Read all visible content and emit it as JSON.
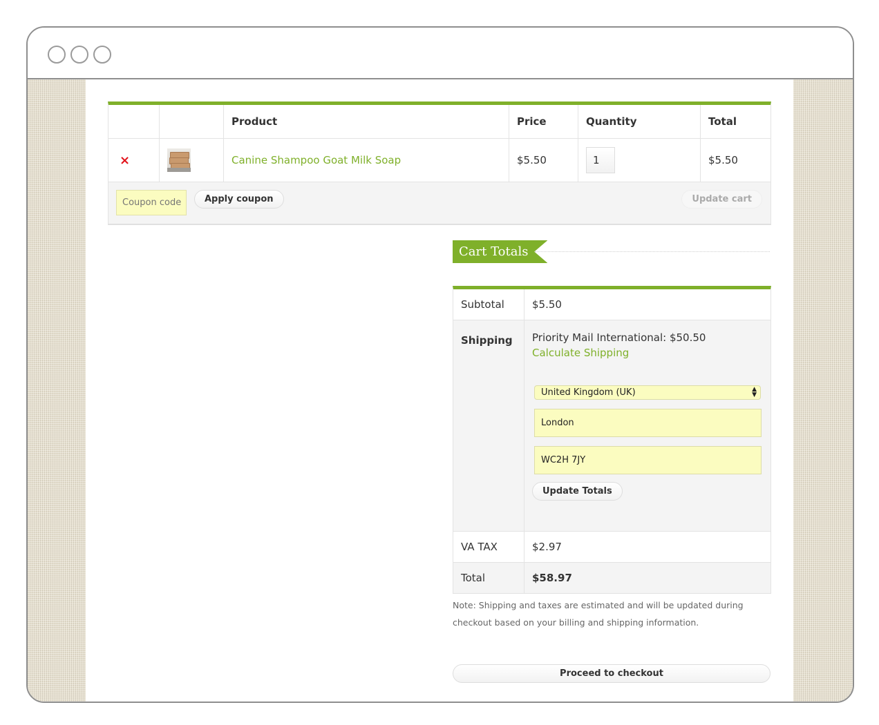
{
  "window": {
    "controls": [
      "close",
      "minimize",
      "maximize"
    ]
  },
  "cart": {
    "headers": [
      "",
      "",
      "Product",
      "Price",
      "Quantity",
      "Total"
    ],
    "items": [
      {
        "remove_icon": "×",
        "thumbnail": "soap-bars-image",
        "product": "Canine Shampoo Goat Milk Soap",
        "price": "$5.50",
        "quantity": "1",
        "total": "$5.50"
      }
    ],
    "coupon_placeholder": "Coupon code",
    "apply_coupon_label": "Apply coupon",
    "update_cart_label": "Update cart"
  },
  "totals": {
    "title": "Cart Totals",
    "subtotal_label": "Subtotal",
    "subtotal_value": "$5.50",
    "shipping_label": "Shipping",
    "shipping_method": "Priority Mail International: $50.50",
    "calculate_shipping_label": "Calculate Shipping",
    "country_selected": "United Kingdom (UK)",
    "city_value": "London",
    "postcode_value": "WC2H 7JY",
    "update_totals_label": "Update Totals",
    "tax_label": "VA TAX",
    "tax_value": "$2.97",
    "total_label": "Total",
    "total_value": "$58.97",
    "note": "Note: Shipping and taxes are estimated and will be updated during checkout based on your billing and shipping information.",
    "checkout_label": "Proceed to checkout"
  },
  "colors": {
    "accent": "#7fb02a",
    "remove": "#e2131b",
    "input_bg": "#fbfcc0"
  }
}
